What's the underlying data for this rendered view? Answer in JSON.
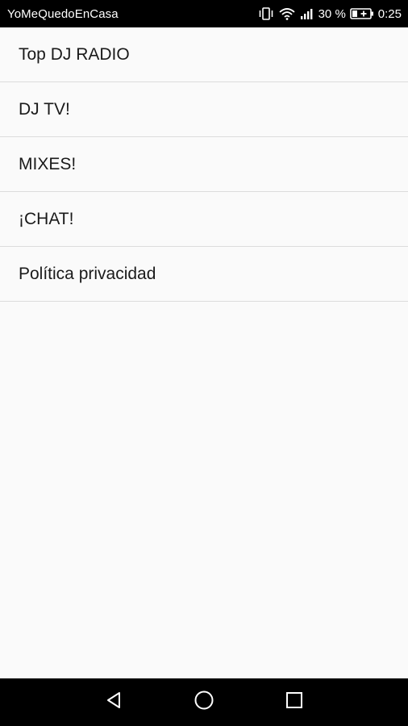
{
  "status_bar": {
    "app_title": "YoMeQuedoEnCasa",
    "battery_percent": "30 %",
    "time": "0:25",
    "icons": [
      "vibrate-icon",
      "wifi-icon",
      "signal-icon",
      "battery-charging-icon"
    ]
  },
  "menu": {
    "items": [
      {
        "label": "Top DJ RADIO"
      },
      {
        "label": "DJ TV!"
      },
      {
        "label": "MIXES!"
      },
      {
        "label": "¡CHAT!"
      },
      {
        "label": "Política privacidad"
      }
    ]
  },
  "nav_bar": {
    "buttons": [
      "back-icon",
      "home-icon",
      "recents-icon"
    ]
  },
  "colors": {
    "background": "#fafafa",
    "bars": "#000000",
    "divider": "#dcdcdc",
    "text": "#1a1a1a"
  }
}
